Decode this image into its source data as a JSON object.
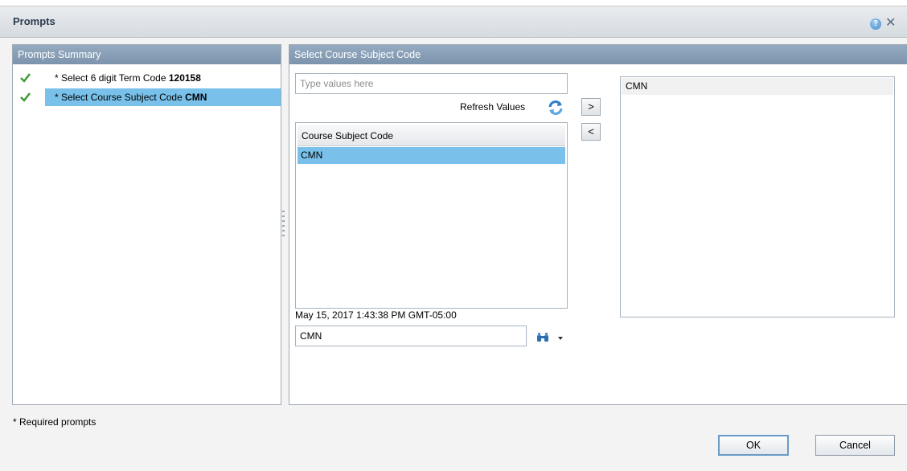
{
  "window": {
    "title": "Prompts",
    "help_glyph": "?",
    "close_glyph": "✕"
  },
  "summary": {
    "header": "Prompts Summary",
    "items": [
      {
        "prefix": "* Select 6 digit Term Code ",
        "value": "120158",
        "selected": false
      },
      {
        "prefix": "* Select Course Subject Code ",
        "value": "CMN",
        "selected": true
      }
    ]
  },
  "detail": {
    "header": "Select Course Subject Code",
    "search_placeholder": "Type values here",
    "refresh_label": "Refresh Values",
    "add_label": ">",
    "remove_label": "<",
    "list_column": "Course Subject Code",
    "list_values": [
      "CMN"
    ],
    "selected_values": [
      "CMN"
    ],
    "timestamp": "May 15, 2017 1:43:38 PM GMT-05:00",
    "value_input": "CMN"
  },
  "footer": {
    "required_note": "* Required prompts",
    "ok_label": "OK",
    "cancel_label": "Cancel"
  },
  "icons": [
    "check-icon",
    "refresh-icon",
    "binoculars-icon",
    "dropdown-arrow-icon",
    "help-icon",
    "close-icon"
  ],
  "colors": {
    "header_blue": "#7c94ad",
    "selection": "#79c1ea",
    "check_green": "#3a9a2f"
  }
}
